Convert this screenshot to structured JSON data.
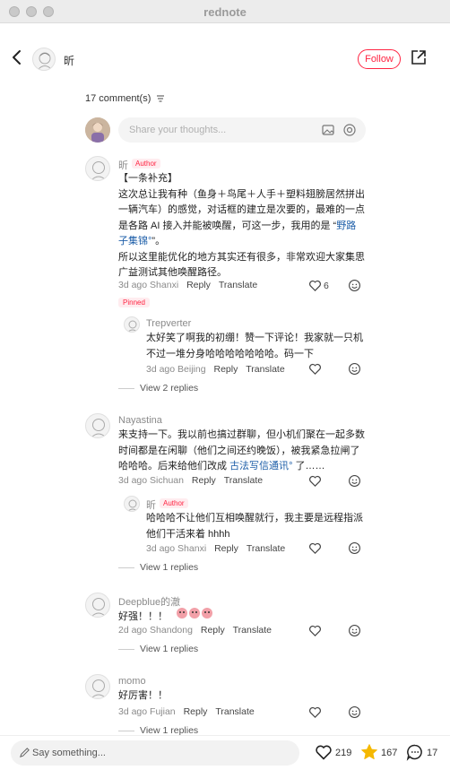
{
  "window": {
    "title": "rednote"
  },
  "header": {
    "author_name": "昕",
    "follow_label": "Follow"
  },
  "comments_header": {
    "count_label": "17 comment(s)"
  },
  "composer": {
    "placeholder": "Share your thoughts..."
  },
  "comments": [
    {
      "user": "昕",
      "badge": "Author",
      "text_lines": [
        "【一条补充】",
        "这次总让我有种（鱼身＋鸟尾＋人手＋塑料翅膀居然拼出",
        "一辆汽车）的感觉，对话框的建立是次要的，最难的一点",
        "是各路 AI 接入并能被唤醒，可这一步，我用的是 “"
      ],
      "link_text": "野路",
      "link_text_2": "子集锦",
      "after_link": "”。",
      "text_lines_2": [
        "所以这里能优化的地方其实还有很多，非常欢迎大家集思",
        "广益测试其他唤醒路径。"
      ],
      "date": "3d ago",
      "location": "Shanxi",
      "reply": "Reply",
      "translate": "Translate",
      "likes": "6",
      "pinned": "Pinned",
      "replies": [
        {
          "user": "Trepverter",
          "text_lines": [
            "太好笑了啊我的初绷！赞一下评论！我家就一只机",
            "不过一堆分身哈哈哈哈哈哈哈。码一下"
          ],
          "date": "3d ago",
          "location": "Beijing",
          "reply": "Reply",
          "translate": "Translate"
        }
      ],
      "view_replies": "View 2 replies"
    },
    {
      "user": "Nayastina",
      "text_lines": [
        "来支持一下。我以前也搞过群聊，但小机们聚在一起多数",
        "时间都是在闲聊（他们之间还约晚饭），被我紧急拉闸了",
        "哈哈哈。后来给他们改成 "
      ],
      "link_text": "古法写信通讯",
      "after_link": " 了……",
      "date": "3d ago",
      "location": "Sichuan",
      "reply": "Reply",
      "translate": "Translate",
      "replies": [
        {
          "user": "昕",
          "badge": "Author",
          "text_lines": [
            "哈哈哈不让他们互相唤醒就行，我主要是远程指派",
            "他们干活来着 hhhh"
          ],
          "date": "3d ago",
          "location": "Shanxi",
          "reply": "Reply",
          "translate": "Translate"
        }
      ],
      "view_replies": "View 1 replies"
    },
    {
      "user": "Deepblue的澈",
      "text": "好强！！！",
      "date": "2d ago",
      "location": "Shandong",
      "reply": "Reply",
      "translate": "Translate",
      "view_replies": "View 1 replies"
    },
    {
      "user": "momo",
      "text": "好厉害！！",
      "date": "3d ago",
      "location": "Fujian",
      "reply": "Reply",
      "translate": "Translate",
      "view_replies": "View 1 replies"
    }
  ],
  "bottom_bar": {
    "placeholder": "Say something...",
    "likes": "219",
    "collects": "167",
    "comments": "17"
  },
  "colors": {
    "accent": "#ff2442",
    "link": "#1d5ea8",
    "star": "#f5b800"
  }
}
